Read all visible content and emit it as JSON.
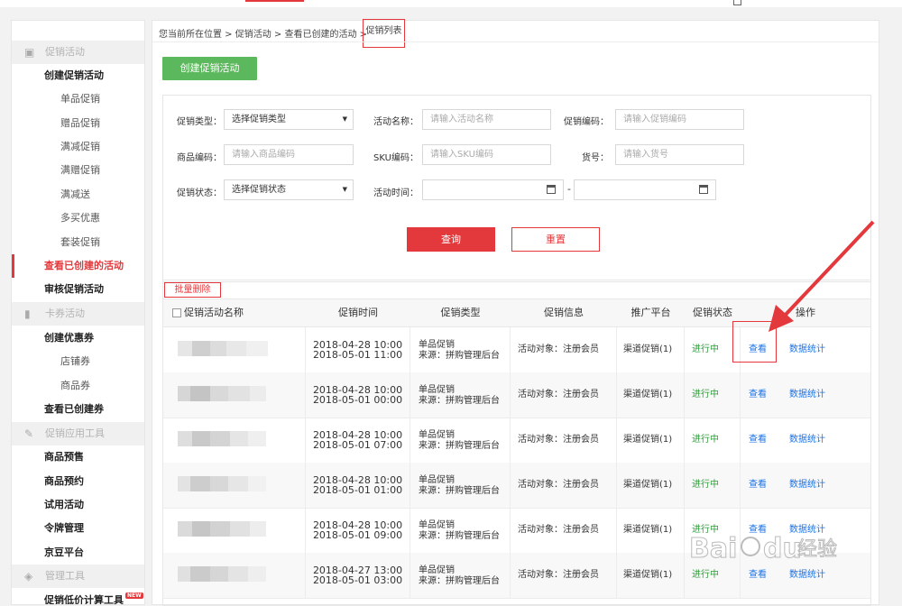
{
  "sidebar": {
    "groups": [
      {
        "label": "促销活动",
        "icon": "shopping-bag-icon"
      },
      {
        "label": "卡券活动",
        "icon": "coupon-icon"
      },
      {
        "label": "促销应用工具",
        "icon": "pencil-icon"
      },
      {
        "label": "管理工具",
        "icon": "tag-icon"
      }
    ],
    "items": [
      {
        "label": "创建促销活动"
      },
      {
        "label": "单品促销"
      },
      {
        "label": "赠品促销"
      },
      {
        "label": "满减促销"
      },
      {
        "label": "满赠促销"
      },
      {
        "label": "满减送"
      },
      {
        "label": "多买优惠"
      },
      {
        "label": "套装促销"
      },
      {
        "label": "查看已创建的活动"
      },
      {
        "label": "审核促销活动"
      },
      {
        "label": "创建优惠券"
      },
      {
        "label": "店铺券"
      },
      {
        "label": "商品券"
      },
      {
        "label": "查看已创建券"
      },
      {
        "label": "商品预售"
      },
      {
        "label": "商品预约"
      },
      {
        "label": "试用活动"
      },
      {
        "label": "令牌管理"
      },
      {
        "label": "京豆平台"
      },
      {
        "label": "促销低价计算工具",
        "badge": "NEW"
      }
    ]
  },
  "breadcrumb": {
    "prefix": "您当前所在位置 > 促销活动 > 查看已创建的活动 >",
    "current": "促销列表"
  },
  "create_button": "创建促销活动",
  "filters": {
    "promo_type_label": "促销类型：",
    "promo_type_value": "选择促销类型",
    "activity_name_label": "活动名称：",
    "activity_name_placeholder": "请输入活动名称",
    "promo_code_label": "促销编码：",
    "promo_code_placeholder": "请输入促销编码",
    "product_code_label": "商品编码：",
    "product_code_placeholder": "请输入商品编码",
    "sku_label": "SKU编码：",
    "sku_placeholder": "请输入SKU编码",
    "item_no_label": "货号：",
    "item_no_placeholder": "请输入货号",
    "status_label": "促销状态：",
    "status_value": "选择促销状态",
    "time_label": "活动时间：",
    "time_sep": "-",
    "query_button": "查询",
    "reset_button": "重置"
  },
  "table": {
    "batch_delete": "批量删除",
    "headers": [
      "促销活动名称",
      "促销时间",
      "促销类型",
      "促销信息",
      "推广平台",
      "促销状态",
      "操作"
    ],
    "rows": [
      {
        "time_start": "2018-04-28 10:00",
        "time_end": "2018-05-01 11:00",
        "type": "单品促销",
        "source": "来源：拼购管理后台",
        "info": "活动对象：注册会员",
        "platform": "渠道促销(1)",
        "status": "进行中",
        "view": "查看",
        "stats": "数据统计"
      },
      {
        "time_start": "2018-04-28 10:00",
        "time_end": "2018-05-01 00:00",
        "type": "单品促销",
        "source": "来源：拼购管理后台",
        "info": "活动对象：注册会员",
        "platform": "渠道促销(1)",
        "status": "进行中",
        "view": "查看",
        "stats": "数据统计"
      },
      {
        "time_start": "2018-04-28 10:00",
        "time_end": "2018-05-01 07:00",
        "type": "单品促销",
        "source": "来源：拼购管理后台",
        "info": "活动对象：注册会员",
        "platform": "渠道促销(1)",
        "status": "进行中",
        "view": "查看",
        "stats": "数据统计"
      },
      {
        "time_start": "2018-04-28 10:00",
        "time_end": "2018-05-01 01:00",
        "type": "单品促销",
        "source": "来源：拼购管理后台",
        "info": "活动对象：注册会员",
        "platform": "渠道促销(1)",
        "status": "进行中",
        "view": "查看",
        "stats": "数据统计"
      },
      {
        "time_start": "2018-04-28 10:00",
        "time_end": "2018-05-01 09:00",
        "type": "单品促销",
        "source": "来源：拼购管理后台",
        "info": "活动对象：注册会员",
        "platform": "渠道促销(1)",
        "status": "进行中",
        "view": "查看",
        "stats": "数据统计"
      },
      {
        "time_start": "2018-04-27 13:00",
        "time_end": "2018-05-01 03:00",
        "type": "单品促销",
        "source": "来源：拼购管理后台",
        "info": "活动对象：注册会员",
        "platform": "渠道促销(1)",
        "status": "进行中",
        "view": "查看",
        "stats": "数据统计"
      }
    ]
  },
  "watermark": {
    "text": "Bai",
    "text2": "du",
    "text3": "经验"
  },
  "colors": {
    "accent": "#e4393c",
    "create_green": "#5cb85c",
    "status_green": "#2e9e3a",
    "link_blue": "#1a73e8"
  }
}
